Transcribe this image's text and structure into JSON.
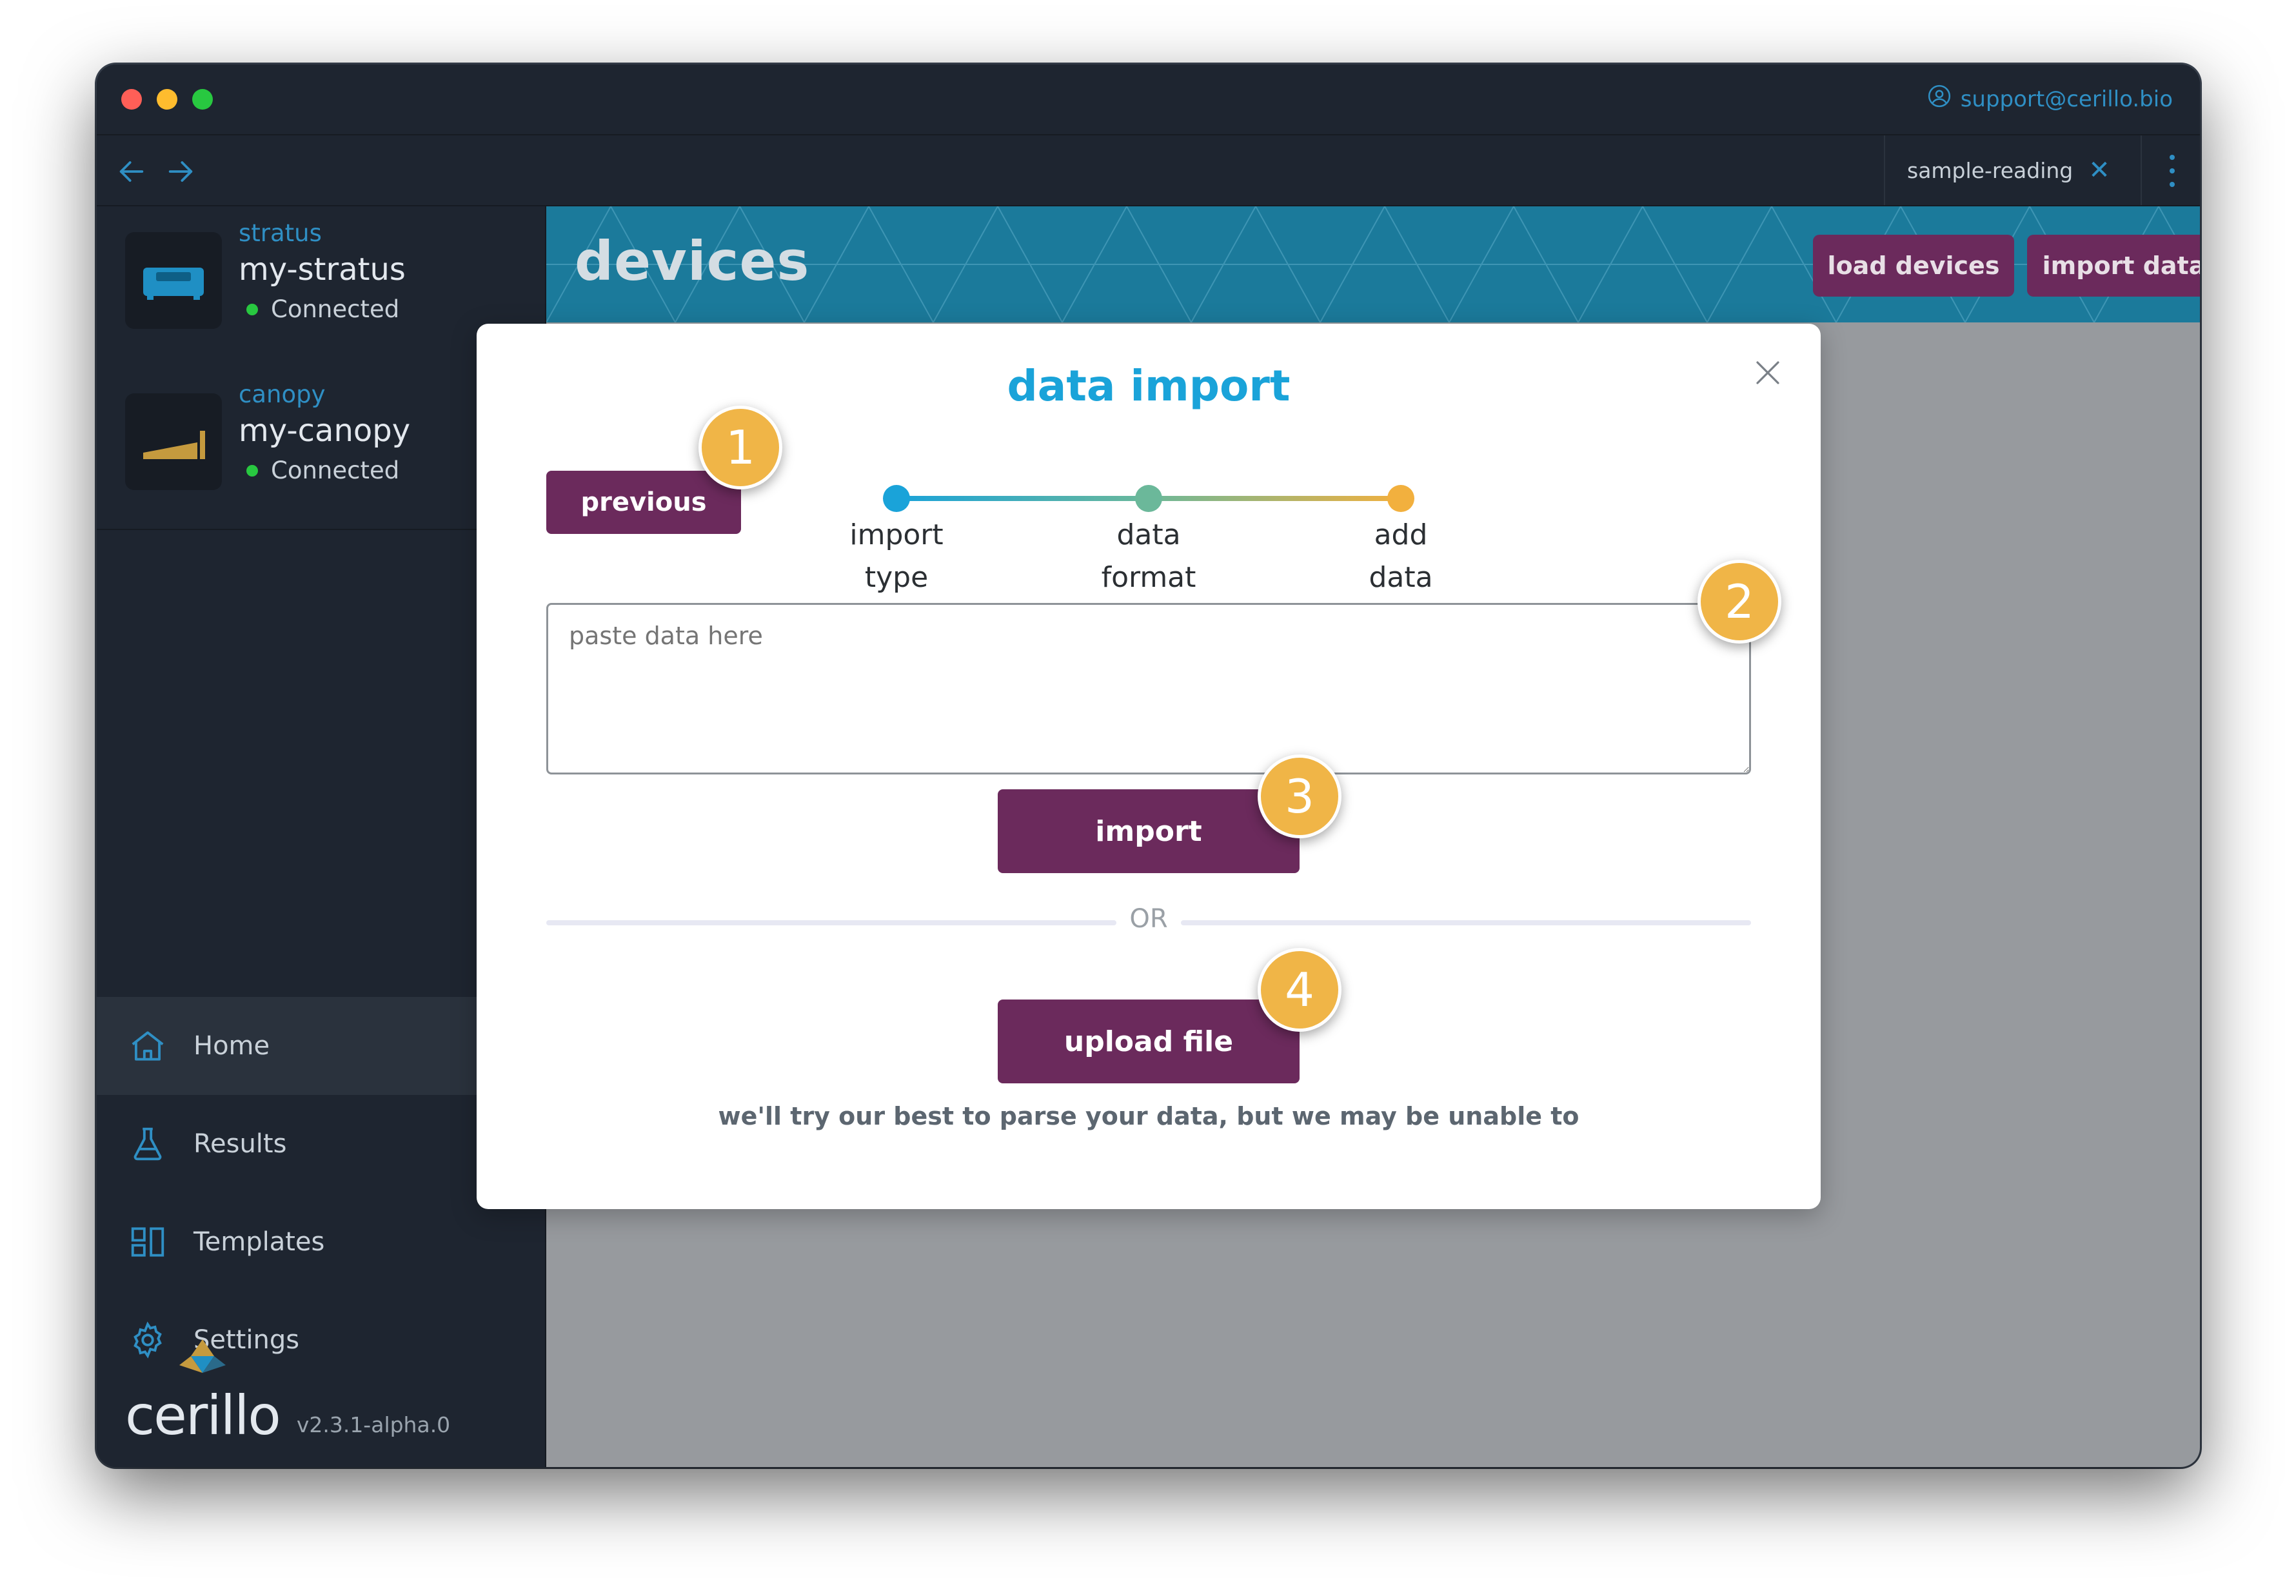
{
  "window": {
    "support_email": "support@cerillo.bio"
  },
  "tabs": [
    {
      "label": "sample-reading"
    }
  ],
  "sidebar": {
    "devices": [
      {
        "kind": "stratus",
        "name": "my-stratus",
        "status": "Connected"
      },
      {
        "kind": "canopy",
        "name": "my-canopy",
        "status": "Connected"
      }
    ],
    "menu": [
      {
        "label": "Home",
        "icon": "home-icon",
        "active": true
      },
      {
        "label": "Results",
        "icon": "flask-icon",
        "active": false
      },
      {
        "label": "Templates",
        "icon": "templates-icon",
        "active": false
      },
      {
        "label": "Settings",
        "icon": "gear-icon",
        "active": false
      }
    ],
    "brand": {
      "logo": "cerillo",
      "version": "v2.3.1-alpha.0"
    }
  },
  "main": {
    "title": "devices",
    "load_devices_label": "load devices",
    "import_data_label": "import data"
  },
  "modal": {
    "title": "data import",
    "previous_label": "previous",
    "steps": [
      {
        "line1": "import",
        "line2": "type",
        "color": "#1aa3d9"
      },
      {
        "line1": "data",
        "line2": "format",
        "color": "#6bb89a"
      },
      {
        "line1": "add",
        "line2": "data",
        "color": "#f2b03e"
      }
    ],
    "paste_placeholder": "paste data here",
    "import_label": "import",
    "or_label": "OR",
    "upload_label": "upload file",
    "hint": "we'll try our best to parse your data, but we may be unable to"
  },
  "callouts": [
    "1",
    "2",
    "3",
    "4"
  ],
  "colors": {
    "accent": "#1aa3d9",
    "button": "#6b2a5c",
    "callout": "#f0b547",
    "connected": "#28c840"
  }
}
